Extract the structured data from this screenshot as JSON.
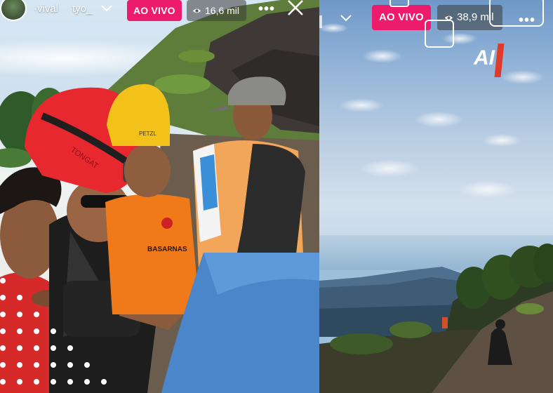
{
  "left_stream": {
    "usernames": [
      "·vival",
      "tyo_"
    ],
    "live_label": "AO VIVO",
    "viewers": "16,6 mil",
    "helmet_brand_red": "TONGAT",
    "helmet_brand_yellow": "PETZL",
    "uniform_name": "BASARNAS",
    "icons": [
      "avatar",
      "chevron-down-icon",
      "eye-icon",
      "more-icon",
      "close-icon"
    ]
  },
  "right_stream": {
    "live_label": "AO VIVO",
    "viewers": "38,9 mil",
    "watermark": "AI",
    "icons": [
      "chevron-down-icon",
      "eye-icon",
      "more-icon"
    ]
  },
  "colors": {
    "live": "#ec1b6b",
    "badge_bg": "rgba(60,60,60,0.55)",
    "helmet_red": "#e8282f",
    "helmet_yellow": "#f2c21b",
    "uniform_orange": "#f07a1a"
  }
}
